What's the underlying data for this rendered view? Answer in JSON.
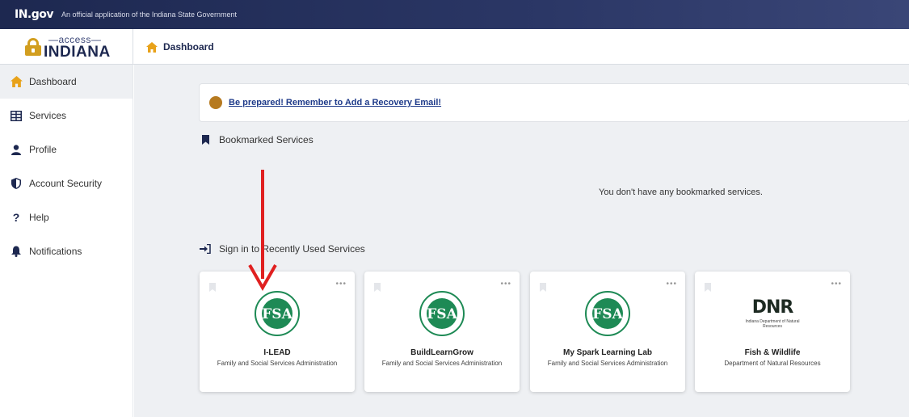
{
  "gov_bar": {
    "logo": "IN.gov",
    "tagline": "An official application of the Indiana State Government"
  },
  "brand": {
    "access": "—access—",
    "state": "INDIANA"
  },
  "breadcrumb": {
    "label": "Dashboard"
  },
  "sidebar": {
    "items": [
      {
        "label": "Dashboard",
        "icon": "home-icon",
        "active": true
      },
      {
        "label": "Services",
        "icon": "grid-icon"
      },
      {
        "label": "Profile",
        "icon": "person-icon"
      },
      {
        "label": "Account Security",
        "icon": "shield-icon"
      },
      {
        "label": "Help",
        "icon": "question-icon"
      },
      {
        "label": "Notifications",
        "icon": "bell-icon"
      }
    ]
  },
  "alert": {
    "text": "Be prepared! Remember to Add a Recovery Email!"
  },
  "bookmarked": {
    "title": "Bookmarked Services",
    "empty_message": "You don't have any bookmarked services."
  },
  "recent": {
    "title": "Sign in to Recently Used Services",
    "cards": [
      {
        "title": "I-LEAD",
        "subtitle": "Family and Social Services Administration",
        "logo": "fssa-logo"
      },
      {
        "title": "BuildLearnGrow",
        "subtitle": "Family and Social Services Administration",
        "logo": "fssa-logo"
      },
      {
        "title": "My Spark Learning Lab",
        "subtitle": "Family and Social Services Administration",
        "logo": "fssa-logo"
      },
      {
        "title": "Fish & Wildlife",
        "subtitle": "Department of Natural Resources",
        "logo": "dnr-logo",
        "logo_text": "DNR",
        "logo_subtext": "Indiana Department of Natural Resources"
      }
    ],
    "more_label": "•••"
  },
  "colors": {
    "navy": "#1d2850",
    "gold": "#d29e1f",
    "fssa_green": "#1e8a55",
    "link_blue": "#1f3b8a",
    "annotation_red": "#e02020"
  }
}
